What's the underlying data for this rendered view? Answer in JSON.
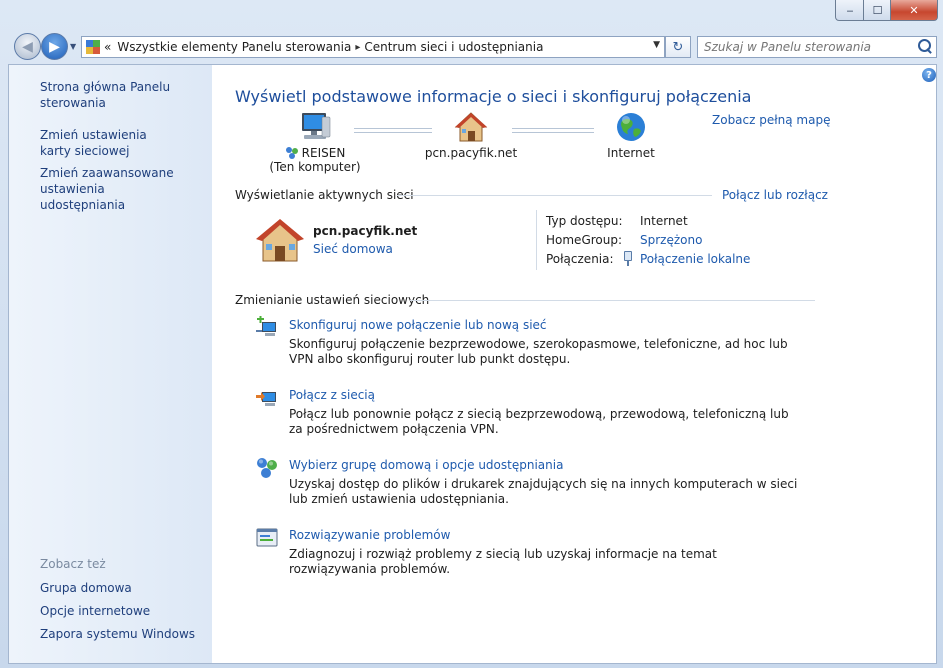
{
  "window": {
    "minimize_glyph": "‒",
    "maximize_glyph": "☐",
    "close_glyph": "✕"
  },
  "address_bar": {
    "overflow_glyph": "«",
    "crumbs": [
      "Wszystkie elementy Panelu sterowania",
      "Centrum sieci i udostępniania"
    ],
    "separator": "▸",
    "search_placeholder": "Szukaj w Panelu sterowania"
  },
  "sidebar": {
    "links": [
      "Strona główna Panelu sterowania",
      "Zmień ustawienia karty sieciowej",
      "Zmień zaawansowane ustawienia udostępniania"
    ],
    "see_also_heading": "Zobacz też",
    "see_also": [
      "Grupa domowa",
      "Opcje internetowe",
      "Zapora systemu Windows"
    ]
  },
  "main": {
    "title": "Wyświetl podstawowe informacje o sieci i skonfiguruj połączenia",
    "full_map_link": "Zobacz pełną mapę",
    "map": {
      "computer_name": "REISEN",
      "computer_sub": "(Ten komputer)",
      "network_name": "pcn.pacyfik.net",
      "internet_label": "Internet"
    },
    "active_networks": {
      "heading": "Wyświetlanie aktywnych sieci",
      "connect_link": "Połącz lub rozłącz",
      "network_name": "pcn.pacyfik.net",
      "network_type": "Sieć domowa",
      "access_type_label": "Typ dostępu:",
      "access_type_value": "Internet",
      "homegroup_label": "HomeGroup:",
      "homegroup_value": "Sprzężono",
      "connections_label": "Połączenia:",
      "connections_value": "Połączenie lokalne"
    },
    "change_settings": {
      "heading": "Zmienianie ustawień sieciowych",
      "tasks": [
        {
          "title": "Skonfiguruj nowe połączenie lub nową sieć",
          "desc": "Skonfiguruj połączenie bezprzewodowe, szerokopasmowe, telefoniczne, ad hoc lub VPN albo skonfiguruj router lub punkt dostępu.",
          "icon": "new-connection-icon"
        },
        {
          "title": "Połącz z siecią",
          "desc": "Połącz lub ponownie połącz z siecią bezprzewodową, przewodową, telefoniczną lub za pośrednictwem połączenia VPN.",
          "icon": "connect-network-icon"
        },
        {
          "title": "Wybierz grupę domową i opcje udostępniania",
          "desc": "Uzyskaj dostęp do plików i drukarek znajdujących się na innych komputerach w sieci lub zmień ustawienia udostępniania.",
          "icon": "homegroup-icon"
        },
        {
          "title": "Rozwiązywanie problemów",
          "desc": "Zdiagnozuj i rozwiąż problemy z siecią lub uzyskaj informacje na temat rozwiązywania problemów.",
          "icon": "troubleshoot-icon"
        }
      ]
    }
  },
  "colors": {
    "link": "#1e5aad",
    "title": "#1e4e9c",
    "sidebar_link": "#1f3f7c",
    "sidebar_bg": "#e6eef8",
    "frame": "#c6d6ea"
  }
}
